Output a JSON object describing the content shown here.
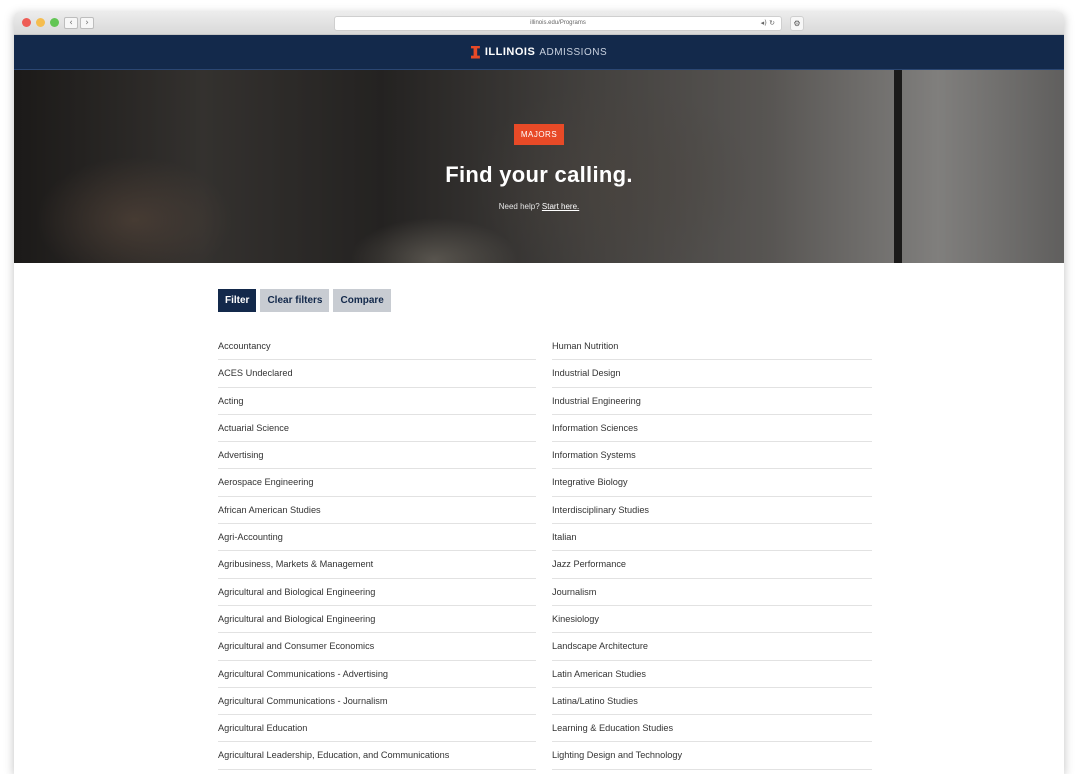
{
  "browser": {
    "url": "illinois.edu/Programs",
    "reload_icon": "◂) ↻",
    "back_icon": "‹",
    "forward_icon": "›",
    "extension_icon": "⚙"
  },
  "header": {
    "logo_strong": "ILLINOIS",
    "logo_light": "ADMISSIONS"
  },
  "hero": {
    "badge": "MAJORS",
    "title": "Find your calling.",
    "help_text": "Need help?",
    "help_link": "Start here."
  },
  "toolbar": {
    "filter_label": "Filter",
    "clear_label": "Clear filters",
    "compare_label": "Compare"
  },
  "programs_left": [
    "Accountancy",
    "ACES Undeclared",
    "Acting",
    "Actuarial Science",
    "Advertising",
    "Aerospace Engineering",
    "African American Studies",
    "Agri-Accounting",
    "Agribusiness, Markets & Management",
    "Agricultural and Biological Engineering",
    "Agricultural and Biological Engineering",
    "Agricultural and Consumer Economics",
    "Agricultural Communications - Advertising",
    "Agricultural Communications - Journalism",
    "Agricultural Education",
    "Agricultural Leadership, Education, and Communications"
  ],
  "programs_right": [
    "Human Nutrition",
    "Industrial Design",
    "Industrial Engineering",
    "Information Sciences",
    "Information Systems",
    "Integrative Biology",
    "Interdisciplinary Studies",
    "Italian",
    "Jazz Performance",
    "Journalism",
    "Kinesiology",
    "Landscape Architecture",
    "Latin American Studies",
    "Latina/Latino Studies",
    "Learning & Education Studies",
    "Lighting Design and Technology"
  ]
}
